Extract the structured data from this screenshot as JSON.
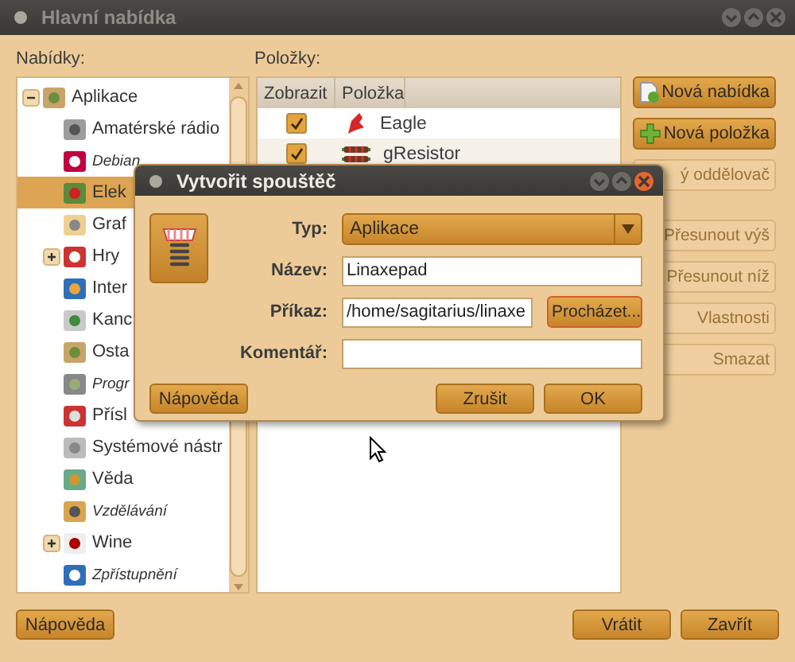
{
  "window": {
    "title": "Hlavní nabídka"
  },
  "menus_label": "Nabídky:",
  "items_label": "Položky:",
  "tree": [
    {
      "label": "Aplikace",
      "italic": false,
      "selected": false,
      "expanded": true,
      "children": [
        {
          "label": "Amatérské rádio",
          "italic": false,
          "selected": false
        },
        {
          "label": "Debian",
          "italic": true,
          "selected": false
        },
        {
          "label": "Elek",
          "italic": false,
          "selected": true
        },
        {
          "label": "Graf",
          "italic": false,
          "selected": false
        },
        {
          "label": "Hry",
          "italic": false,
          "selected": false,
          "expanded": false
        },
        {
          "label": "Inter",
          "italic": false,
          "selected": false
        },
        {
          "label": "Kanc",
          "italic": false,
          "selected": false
        },
        {
          "label": "Osta",
          "italic": false,
          "selected": false
        },
        {
          "label": "Progr",
          "italic": true,
          "selected": false
        },
        {
          "label": "Přísl",
          "italic": false,
          "selected": false
        },
        {
          "label": "Systémové nástr",
          "italic": false,
          "selected": false
        },
        {
          "label": "Věda",
          "italic": false,
          "selected": false
        },
        {
          "label": "Vzdělávání",
          "italic": true,
          "selected": false
        },
        {
          "label": "Wine",
          "italic": false,
          "selected": false,
          "expanded": false
        },
        {
          "label": "Zpřístupnění",
          "italic": true,
          "selected": false
        }
      ]
    }
  ],
  "table": {
    "columns": [
      "Zobrazit",
      "Položka"
    ],
    "rows": [
      {
        "shown": true,
        "label": "Eagle"
      },
      {
        "shown": true,
        "label": "gResistor"
      }
    ]
  },
  "side_buttons": [
    {
      "label": "Nová nabídka",
      "disabled": false
    },
    {
      "label": "Nová položka",
      "disabled": false
    },
    {
      "label": "ý oddělovač",
      "disabled": true
    },
    {
      "label": "Přesunout výš",
      "disabled": true
    },
    {
      "label": "Přesunout níž",
      "disabled": true
    },
    {
      "label": "Vlastnosti",
      "disabled": true
    },
    {
      "label": "Smazat",
      "disabled": true
    }
  ],
  "bottom_buttons": {
    "help": "Nápověda",
    "revert": "Vrátit",
    "close": "Zavřít"
  },
  "dialog": {
    "title": "Vytvořit spouštěč",
    "fields": [
      {
        "kind": "combo",
        "label": "Typ:",
        "value": "Aplikace"
      },
      {
        "kind": "text",
        "label": "Název:",
        "value": "Linaxepad"
      },
      {
        "kind": "browse",
        "label": "Příkaz:",
        "value": "/home/sagitarius/linaxe",
        "button": "Procházet..."
      },
      {
        "kind": "text",
        "label": "Komentář:"
      }
    ],
    "help": "Nápověda",
    "cancel": "Zrušit",
    "ok": "OK"
  }
}
